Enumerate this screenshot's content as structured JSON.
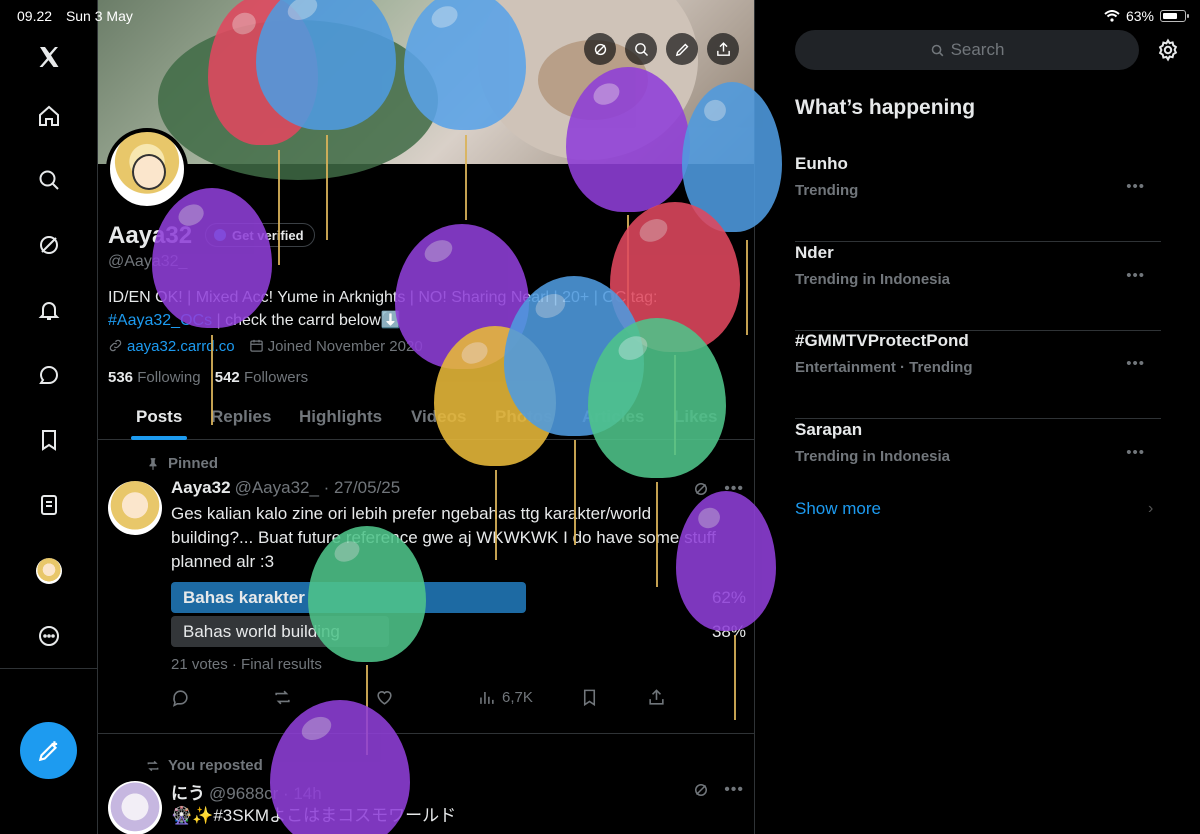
{
  "status_bar": {
    "time": "09.22",
    "date": "Sun 3 May",
    "battery": "63%"
  },
  "nav": {
    "items": [
      "x-logo-icon",
      "home-icon",
      "search-icon",
      "grok-icon",
      "notifications-icon",
      "messages-icon",
      "bookmarks-icon",
      "lists-icon",
      "profile-avatar",
      "more-icon"
    ]
  },
  "profile": {
    "name": "Aaya32",
    "verified_label": "Get verified",
    "handle": "@Aaya32_",
    "bio_line1": "ID/EN OK! | Mixed Acc! Yume in Arknights | NO! Sharing Nearl | 20+ | OC tag:",
    "bio_hashtag": "#Aaya32_OCs",
    "bio_line2_rest": " | check the carrd below⬇️",
    "link": "aaya32.carrd.co",
    "joined": "Joined November 2020",
    "following_count": "536",
    "following_label": "Following",
    "followers_count": "542",
    "followers_label": "Followers"
  },
  "tabs": [
    "Posts",
    "Replies",
    "Highlights",
    "Videos",
    "Photos",
    "Articles",
    "Likes"
  ],
  "pinned_post": {
    "label": "Pinned",
    "name": "Aaya32",
    "handle_time": "@Aaya32_ · 27/05/25",
    "text": "Ges kalian kalo zine ori lebih prefer ngebahas ttg karakter/world building?... Buat future reference gwe aj WKWKWK I do have some stuff planned alr :3",
    "poll": [
      {
        "label": "Bahas karakter",
        "percent": "62%",
        "fraction": 0.62,
        "winner": true
      },
      {
        "label": "Bahas world building",
        "percent": "38%",
        "fraction": 0.38,
        "winner": false
      }
    ],
    "poll_footer": "21 votes · Final results",
    "views": "6,7K"
  },
  "repost": {
    "label": "You reposted",
    "name": "にう",
    "handle_time": "@9688cr · 14h",
    "text": "🎡✨#3SKMよこはまコスモワールド"
  },
  "right": {
    "search_placeholder": "Search",
    "section_title": "What’s happening",
    "trends": [
      {
        "name": "Eunho",
        "meta": "Trending"
      },
      {
        "name": "Nder",
        "meta": "Trending in Indonesia"
      },
      {
        "name": "#GMMTVProtectPond",
        "meta": "Entertainment · Trending"
      },
      {
        "name": "Sarapan",
        "meta": "Trending in Indonesia"
      }
    ],
    "show_more": "Show more"
  },
  "colors": {
    "accent": "#1d9bf0",
    "background": "#000000",
    "muted": "#71767b",
    "border": "#2f3336"
  }
}
